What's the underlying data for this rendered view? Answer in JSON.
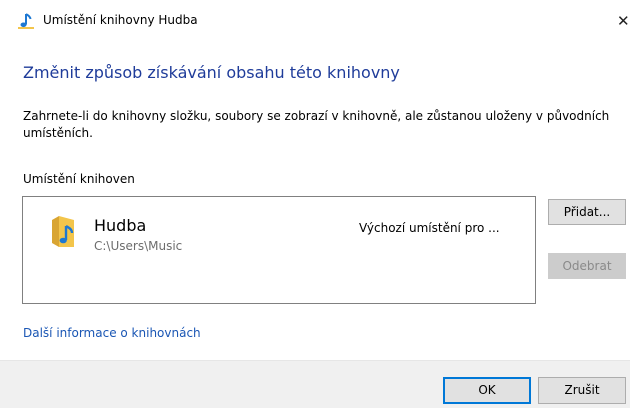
{
  "window": {
    "title": "Umístění knihovny Hudba",
    "close_glyph": "✕"
  },
  "main": {
    "heading": "Změnit způsob získávání obsahu této knihovny",
    "description": "Zahrnete-li do knihovny složku, soubory se zobrazí v knihovně, ale zůstanou uloženy v původních umístěních.",
    "section_label": "Umístění knihoven"
  },
  "locations": [
    {
      "name": "Hudba",
      "path": "C:\\Users\\Music",
      "status": "Výchozí umístění pro ...",
      "icon": "music-folder-icon"
    }
  ],
  "buttons": {
    "add": "Přidat...",
    "remove": "Odebrat",
    "ok": "OK",
    "cancel": "Zrušit"
  },
  "link": {
    "more_info": "Další informace o knihovnách"
  },
  "colors": {
    "heading": "#1f3c9a",
    "link": "#1a56b4",
    "accent": "#0078d7",
    "folder": "#f3c54b",
    "music_note": "#1e78d2"
  }
}
